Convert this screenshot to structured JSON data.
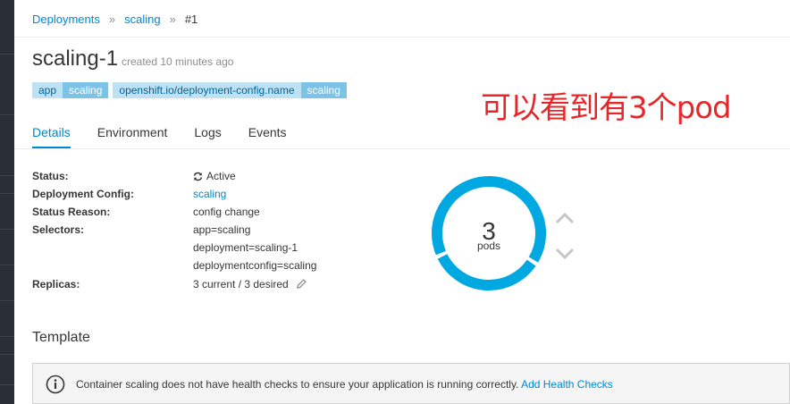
{
  "breadcrumb": {
    "deployments": "Deployments",
    "scaling": "scaling",
    "current": "#1"
  },
  "title": "scaling-1",
  "created": "created 10 minutes ago",
  "labels": [
    {
      "key": "app",
      "value": "scaling"
    },
    {
      "key": "openshift.io/deployment-config.name",
      "value": "scaling"
    }
  ],
  "annotation_note": "可以看到有3个pod",
  "tabs": [
    "Details",
    "Environment",
    "Logs",
    "Events"
  ],
  "details": {
    "status_label": "Status:",
    "status_value": "Active",
    "dc_label": "Deployment Config:",
    "dc_value": "scaling",
    "reason_label": "Status Reason:",
    "reason_value": "config change",
    "selectors_label": "Selectors:",
    "selectors": [
      "app=scaling",
      "deployment=scaling-1",
      "deploymentconfig=scaling"
    ],
    "replicas_label": "Replicas:",
    "replicas_value": "3 current / 3 desired"
  },
  "pods": {
    "count": "3",
    "label": "pods"
  },
  "template_title": "Template",
  "alert": {
    "message": "Container scaling does not have health checks to ensure your application is running correctly.",
    "link": "Add Health Checks"
  },
  "colors": {
    "accent": "#0088ce",
    "donut": "#00a8e1",
    "note": "#e8262a"
  }
}
